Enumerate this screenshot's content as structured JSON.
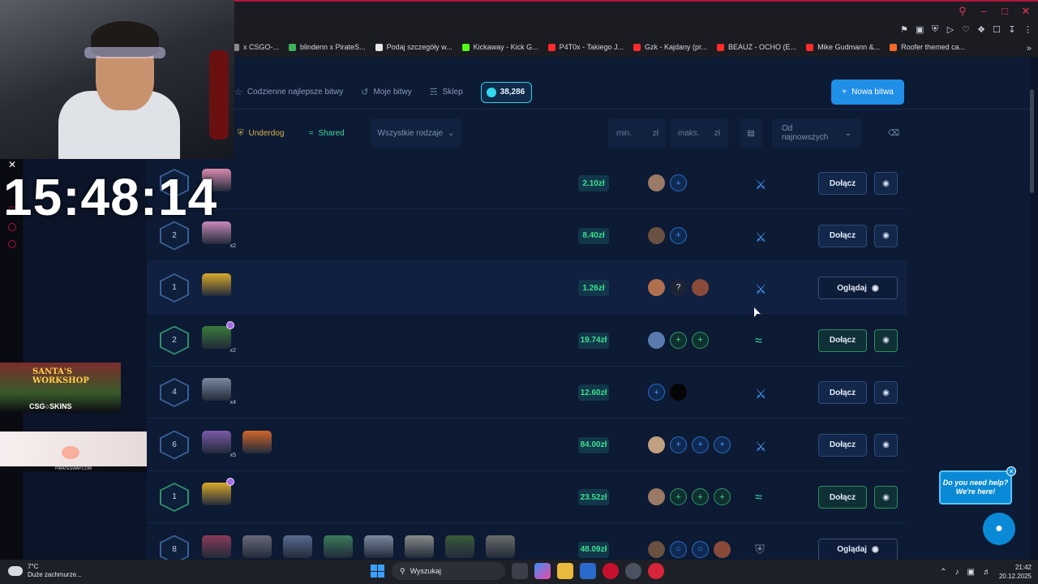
{
  "browser": {
    "bookmarks": [
      {
        "label": "x CSGO-...",
        "color": "#8a8a8a"
      },
      {
        "label": "blindenn x PirateS...",
        "color": "#3cb35a"
      },
      {
        "label": "Podaj szczegóły w...",
        "color": "#e8e8e8"
      },
      {
        "label": "Kickaway - Kick G...",
        "color": "#53fc18"
      },
      {
        "label": "P4T0x - Takiego J...",
        "color": "#ff2a2a"
      },
      {
        "label": "Gzk - Kajdany (pr...",
        "color": "#ff2a2a"
      },
      {
        "label": "BEAUZ - OCHO (E...",
        "color": "#ff2a2a"
      },
      {
        "label": "Mike Gudmann &...",
        "color": "#ff2a2a"
      },
      {
        "label": "Roofer themed ca...",
        "color": "#f06a25"
      }
    ]
  },
  "stream": {
    "timer": "15:48:14",
    "promo_title": "SANTA'S WORKSHOP",
    "promo_brand": "CSG○SKINS",
    "promo2_site": "PIRATESWAP.COM"
  },
  "nav": {
    "daily": "Codzienne najlepsze bitwy",
    "my_battles": "Moje bitwy",
    "shop": "Sklep",
    "balance": "38,286",
    "new_battle": "Nowa bitwa"
  },
  "filters": {
    "underdog": "Underdog",
    "shared": "Shared",
    "types": "Wszystkie rodzaje",
    "min_placeholder": "min.",
    "max_placeholder": "maks.",
    "currency": "zł",
    "sort": "Od najnowszych"
  },
  "rows": [
    {
      "round": "1",
      "price": "2.10zł",
      "mode": "crossed-swords",
      "action": "Dołącz",
      "green": false,
      "cases": [
        {
          "color": "#d88ab0",
          "mult": ""
        }
      ],
      "players": [
        "avatar",
        "plus"
      ]
    },
    {
      "round": "2",
      "price": "8.40zł",
      "mode": "crossed-swords",
      "action": "Dołącz",
      "green": false,
      "cases": [
        {
          "color": "#c98ab8",
          "mult": "x2"
        }
      ],
      "players": [
        "avatar",
        "plus"
      ]
    },
    {
      "round": "1",
      "price": "1.26zł",
      "mode": "crossed-swords",
      "action": "Oglądaj",
      "green": false,
      "cases": [
        {
          "color": "#d8a92a",
          "mult": ""
        }
      ],
      "players": [
        "avatar",
        "question",
        "avatar"
      ]
    },
    {
      "round": "2",
      "price": "19.74zł",
      "mode": "shared",
      "action": "Dołącz",
      "green": true,
      "cases": [
        {
          "color": "#3a7a3a",
          "mult": "x2",
          "badge": true
        }
      ],
      "players": [
        "avatar",
        "plus",
        "plus"
      ]
    },
    {
      "round": "4",
      "price": "12.60zł",
      "mode": "crossed-swords",
      "action": "Dołącz",
      "green": false,
      "cases": [
        {
          "color": "#7a8aa0",
          "mult": "x4"
        }
      ],
      "players": [
        "plus",
        "dark"
      ]
    },
    {
      "round": "6",
      "price": "84.00zł",
      "mode": "crossed-swords",
      "action": "Dołącz",
      "green": false,
      "cases": [
        {
          "color": "#7a5aa8",
          "mult": "x5"
        },
        {
          "color": "#d0662a",
          "mult": ""
        }
      ],
      "players": [
        "avatar",
        "plus",
        "plus",
        "plus"
      ]
    },
    {
      "round": "1",
      "price": "23.52zł",
      "mode": "shared",
      "action": "Dołącz",
      "green": true,
      "cases": [
        {
          "color": "#d8a92a",
          "mult": "",
          "badge": true
        }
      ],
      "players": [
        "avatar",
        "plus",
        "plus",
        "plus"
      ]
    },
    {
      "round": "8",
      "price": "48.09zł",
      "mode": "underdog",
      "action": "Oglądaj",
      "green": false,
      "cases": [
        {
          "color": "#8a3a5a",
          "mult": ""
        },
        {
          "color": "#6a6a78",
          "mult": ""
        },
        {
          "color": "#5a6a90",
          "mult": ""
        },
        {
          "color": "#3a7a5a",
          "mult": ""
        },
        {
          "color": "#7a8aa0",
          "mult": ""
        },
        {
          "color": "#8a8a8a",
          "mult": ""
        },
        {
          "color": "#3a5a3a",
          "mult": ""
        },
        {
          "color": "#6a6a6a",
          "mult": ""
        }
      ],
      "players": [
        "avatar",
        "ring",
        "ring",
        "avatar"
      ]
    }
  ],
  "help": {
    "text": "Do you need help? We're here!"
  },
  "taskbar": {
    "temp": "7°C",
    "weather": "Duże zachmurze...",
    "search": "Wyszukaj",
    "time": "21:42",
    "date": "20.12.2025"
  }
}
